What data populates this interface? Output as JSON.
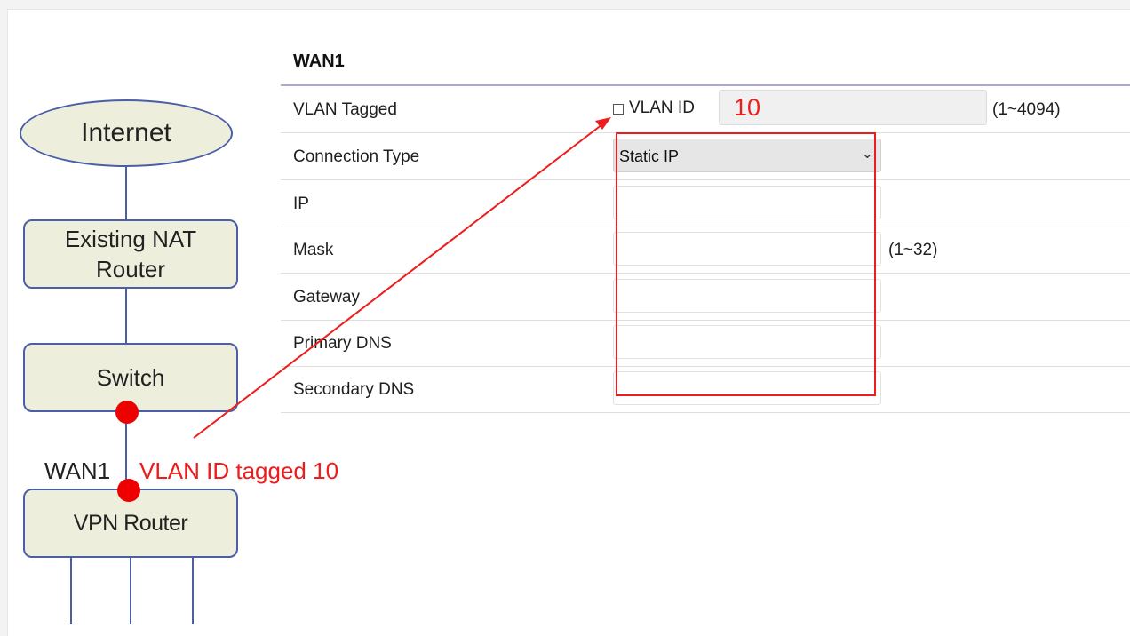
{
  "diagram": {
    "internet": "Internet",
    "nat_router_line1": "Existing NAT",
    "nat_router_line2": "Router",
    "switch": "Switch",
    "vpn_router": "VPN Router",
    "wan_label": "WAN1",
    "vlan_annotation": "VLAN ID tagged 10",
    "annotation_color": "#ee1c1c",
    "node_fill": "#eeeedd",
    "node_border": "#4a5fa6"
  },
  "form": {
    "section_title": "WAN1",
    "vlan_tagged": {
      "label": "VLAN Tagged",
      "checkbox_label": "VLAN ID",
      "checked": false,
      "value": "10",
      "range": "(1~4094)"
    },
    "connection_type": {
      "label": "Connection Type",
      "selected": "Static IP"
    },
    "ip": {
      "label": "IP",
      "value": ""
    },
    "mask": {
      "label": "Mask",
      "value": "",
      "range": "(1~32)"
    },
    "gateway": {
      "label": "Gateway",
      "value": ""
    },
    "primary_dns": {
      "label": "Primary DNS",
      "value": ""
    },
    "secondary_dns": {
      "label": "Secondary DNS",
      "value": ""
    }
  }
}
